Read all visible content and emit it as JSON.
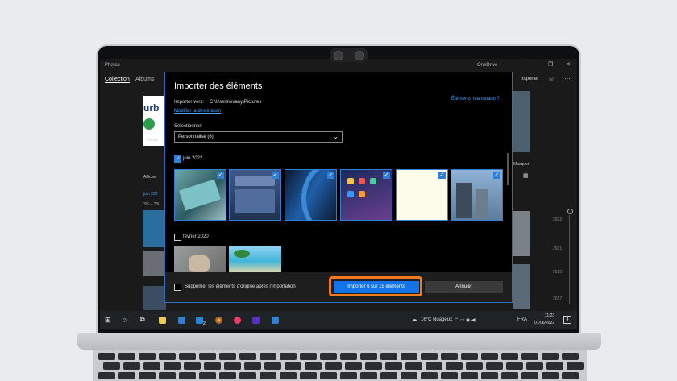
{
  "app": {
    "title": "Photos",
    "onedrive": "OneDrive",
    "nav": [
      "Collection",
      "Albums"
    ],
    "import_label": "Importer",
    "window_controls": [
      "—",
      "❐",
      "✕"
    ]
  },
  "background_fragments": {
    "logo_text": "urb",
    "recent_label": "Recen",
    "show_label": "Afficher",
    "date_link": "juin 202",
    "date_range": "3/6 – 7/6",
    "masquer": "Masquer",
    "timeline": [
      "2022",
      "2021",
      "2020",
      "2017"
    ]
  },
  "dialog": {
    "title": "Importer des éléments",
    "import_to_label": "Importer vers:",
    "import_to_path": "C:\\Users\\evany\\Pictures",
    "missing_link": "Éléments manquants?",
    "change_dest_link": "Modifier la destination",
    "select_label": "Sélectionner:",
    "select_value": "Personnalisé (6)",
    "groups": [
      {
        "label": "juin 2022",
        "checked": true,
        "count": 6
      },
      {
        "label": "février 2020",
        "checked": false,
        "count": 2
      }
    ],
    "delete_originals_label": "Supprimer les éléments d'origine après l'importation",
    "import_button": "Importer 6 sur 15 éléments",
    "cancel_button": "Annuler"
  },
  "taskbar": {
    "weather": "16°C Nuageux",
    "language": "FRA",
    "time": "11:23",
    "date": "07/06/2022",
    "notification_count": "4",
    "mail_badge": "2"
  },
  "colors": {
    "accent": "#1473e6",
    "highlight": "#f07a1d",
    "link": "#4aa3ff"
  }
}
